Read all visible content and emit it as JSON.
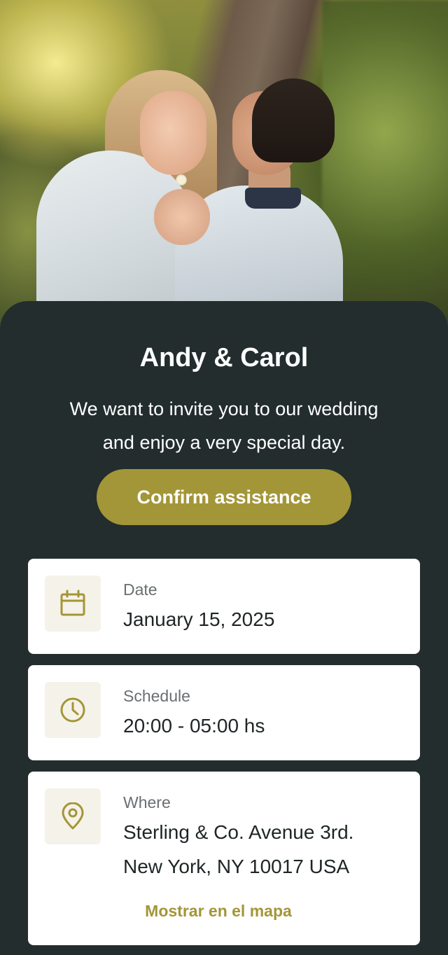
{
  "colors": {
    "background": "#232d2e",
    "accent": "#a39638",
    "card": "#ffffff",
    "icon_bg": "#f5f2e9"
  },
  "hero": {
    "icon": "couple-photo"
  },
  "header": {
    "title": "Andy & Carol",
    "subtitle_line1": "We want to invite you to our wedding",
    "subtitle_line2": "and enjoy a very special day."
  },
  "actions": {
    "confirm_label": "Confirm assistance"
  },
  "details": {
    "date": {
      "icon": "calendar-icon",
      "label": "Date",
      "value": "January 15, 2025"
    },
    "schedule": {
      "icon": "clock-icon",
      "label": "Schedule",
      "value": "20:00 - 05:00 hs"
    },
    "where": {
      "icon": "map-pin-icon",
      "label": "Where",
      "address_line1": "Sterling & Co. Avenue 3rd.",
      "address_line2": "New York, NY 10017 USA",
      "map_link": "Mostrar en el mapa"
    }
  }
}
